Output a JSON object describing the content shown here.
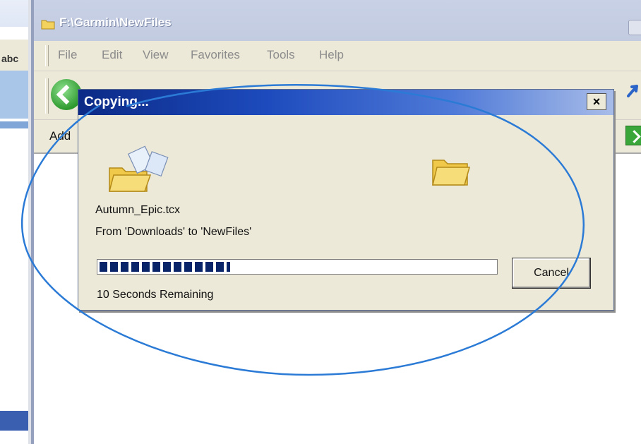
{
  "explorer": {
    "title": "F:\\Garmin\\NewFiles",
    "menu": [
      "File",
      "Edit",
      "View",
      "Favorites",
      "Tools",
      "Help"
    ],
    "address_label": "Add"
  },
  "background_window": {
    "partial_text": "abc"
  },
  "dialog": {
    "title": "Copying...",
    "close_glyph": "×",
    "file_name": "Autumn_Epic.tcx",
    "from_to": "From 'Downloads' to 'NewFiles'",
    "progress": 0.33,
    "remaining": "10 Seconds Remaining",
    "cancel_label": "Cancel"
  },
  "colors": {
    "dialog_title": "#0c2a86",
    "progress_block": "#0a246a",
    "annotation": "#2b7bd6"
  }
}
